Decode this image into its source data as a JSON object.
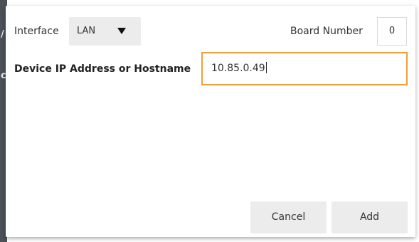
{
  "backdrop": {
    "edge_chars": [
      "/",
      "c"
    ]
  },
  "dialog": {
    "interface": {
      "label": "Interface",
      "selected": "LAN"
    },
    "board_number": {
      "label": "Board Number",
      "value": "0"
    },
    "device_address": {
      "label": "Device IP Address or Hostname",
      "value": "10.85.0.49"
    },
    "buttons": {
      "cancel": "Cancel",
      "add": "Add"
    }
  },
  "colors": {
    "focus_border": "#f19e38",
    "button_bg": "#ececec",
    "backdrop_strip": "#4b5157"
  }
}
